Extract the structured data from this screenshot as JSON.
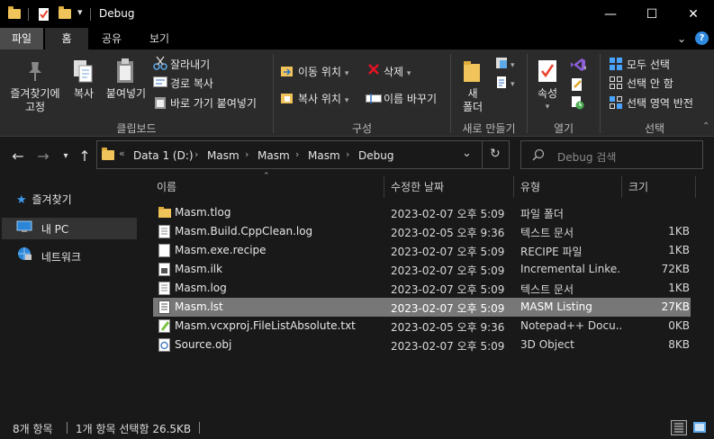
{
  "titlebar": {
    "title": "Debug",
    "quick_access_dropdown": "▾",
    "minimize": "—",
    "maximize": "☐",
    "close": "✕"
  },
  "ribbon_tabs": [
    "파일",
    "홈",
    "공유",
    "보기"
  ],
  "ribbon": {
    "clipboard": {
      "pin_label_1": "즐겨찾기에",
      "pin_label_2": "고정",
      "copy": "복사",
      "paste": "붙여넣기",
      "cut": "잘라내기",
      "copy_path": "경로 복사",
      "paste_shortcut": "바로 가기 붙여넣기",
      "group": "클립보드"
    },
    "organize": {
      "move_to": "이동 위치",
      "copy_to": "복사 위치",
      "delete": "삭제",
      "rename": "이름 바꾸기",
      "group": "구성"
    },
    "new": {
      "new_folder_1": "새",
      "new_folder_2": "폴더",
      "group": "새로 만들기"
    },
    "open": {
      "properties": "속성",
      "group": "열기"
    },
    "select": {
      "select_all": "모두 선택",
      "select_none": "선택 안 함",
      "invert": "선택 영역 반전",
      "group": "선택"
    }
  },
  "address": {
    "prefix": "«",
    "crumbs": [
      "Data 1 (D:)",
      "Masm",
      "Masm",
      "Masm",
      "Debug"
    ],
    "dropdown": "⌄",
    "refresh": "↻"
  },
  "search": {
    "placeholder": "Debug 검색"
  },
  "nav": {
    "quick_access": "즐겨찾기",
    "this_pc": "내 PC",
    "network": "네트워크"
  },
  "columns": {
    "name": "이름",
    "date": "수정한 날짜",
    "type": "유형",
    "size": "크기"
  },
  "files": [
    {
      "name": "Masm.tlog",
      "date": "2023-02-07 오후 5:09",
      "type": "파일 폴더",
      "size": "",
      "icon": "folder-icon"
    },
    {
      "name": "Masm.Build.CppClean.log",
      "date": "2023-02-05 오후 9:36",
      "type": "텍스트 문서",
      "size": "1KB",
      "icon": "text-file-icon"
    },
    {
      "name": "Masm.exe.recipe",
      "date": "2023-02-07 오후 5:09",
      "type": "RECIPE 파일",
      "size": "1KB",
      "icon": "blank-file-icon"
    },
    {
      "name": "Masm.ilk",
      "date": "2023-02-07 오후 5:09",
      "type": "Incremental Linke...",
      "size": "72KB",
      "icon": "ilk-file-icon"
    },
    {
      "name": "Masm.log",
      "date": "2023-02-07 오후 5:09",
      "type": "텍스트 문서",
      "size": "1KB",
      "icon": "text-file-icon"
    },
    {
      "name": "Masm.lst",
      "date": "2023-02-07 오후 5:09",
      "type": "MASM Listing",
      "size": "27KB",
      "icon": "listing-file-icon"
    },
    {
      "name": "Masm.vcxproj.FileListAbsolute.txt",
      "date": "2023-02-05 오후 9:36",
      "type": "Notepad++ Docu...",
      "size": "0KB",
      "icon": "notepadpp-file-icon"
    },
    {
      "name": "Source.obj",
      "date": "2023-02-07 오후 5:09",
      "type": "3D Object",
      "size": "8KB",
      "icon": "obj-file-icon"
    }
  ],
  "status": {
    "item_count": "8개 항목",
    "selection": "1개 항목 선택함 26.5KB"
  },
  "colors": {
    "background": "#191919",
    "ribbon": "#2b2b2b",
    "selected_row": "#777777",
    "folder": "#f0c45a",
    "accent_blue": "#4aa3ff",
    "delete_red": "#e81123"
  }
}
